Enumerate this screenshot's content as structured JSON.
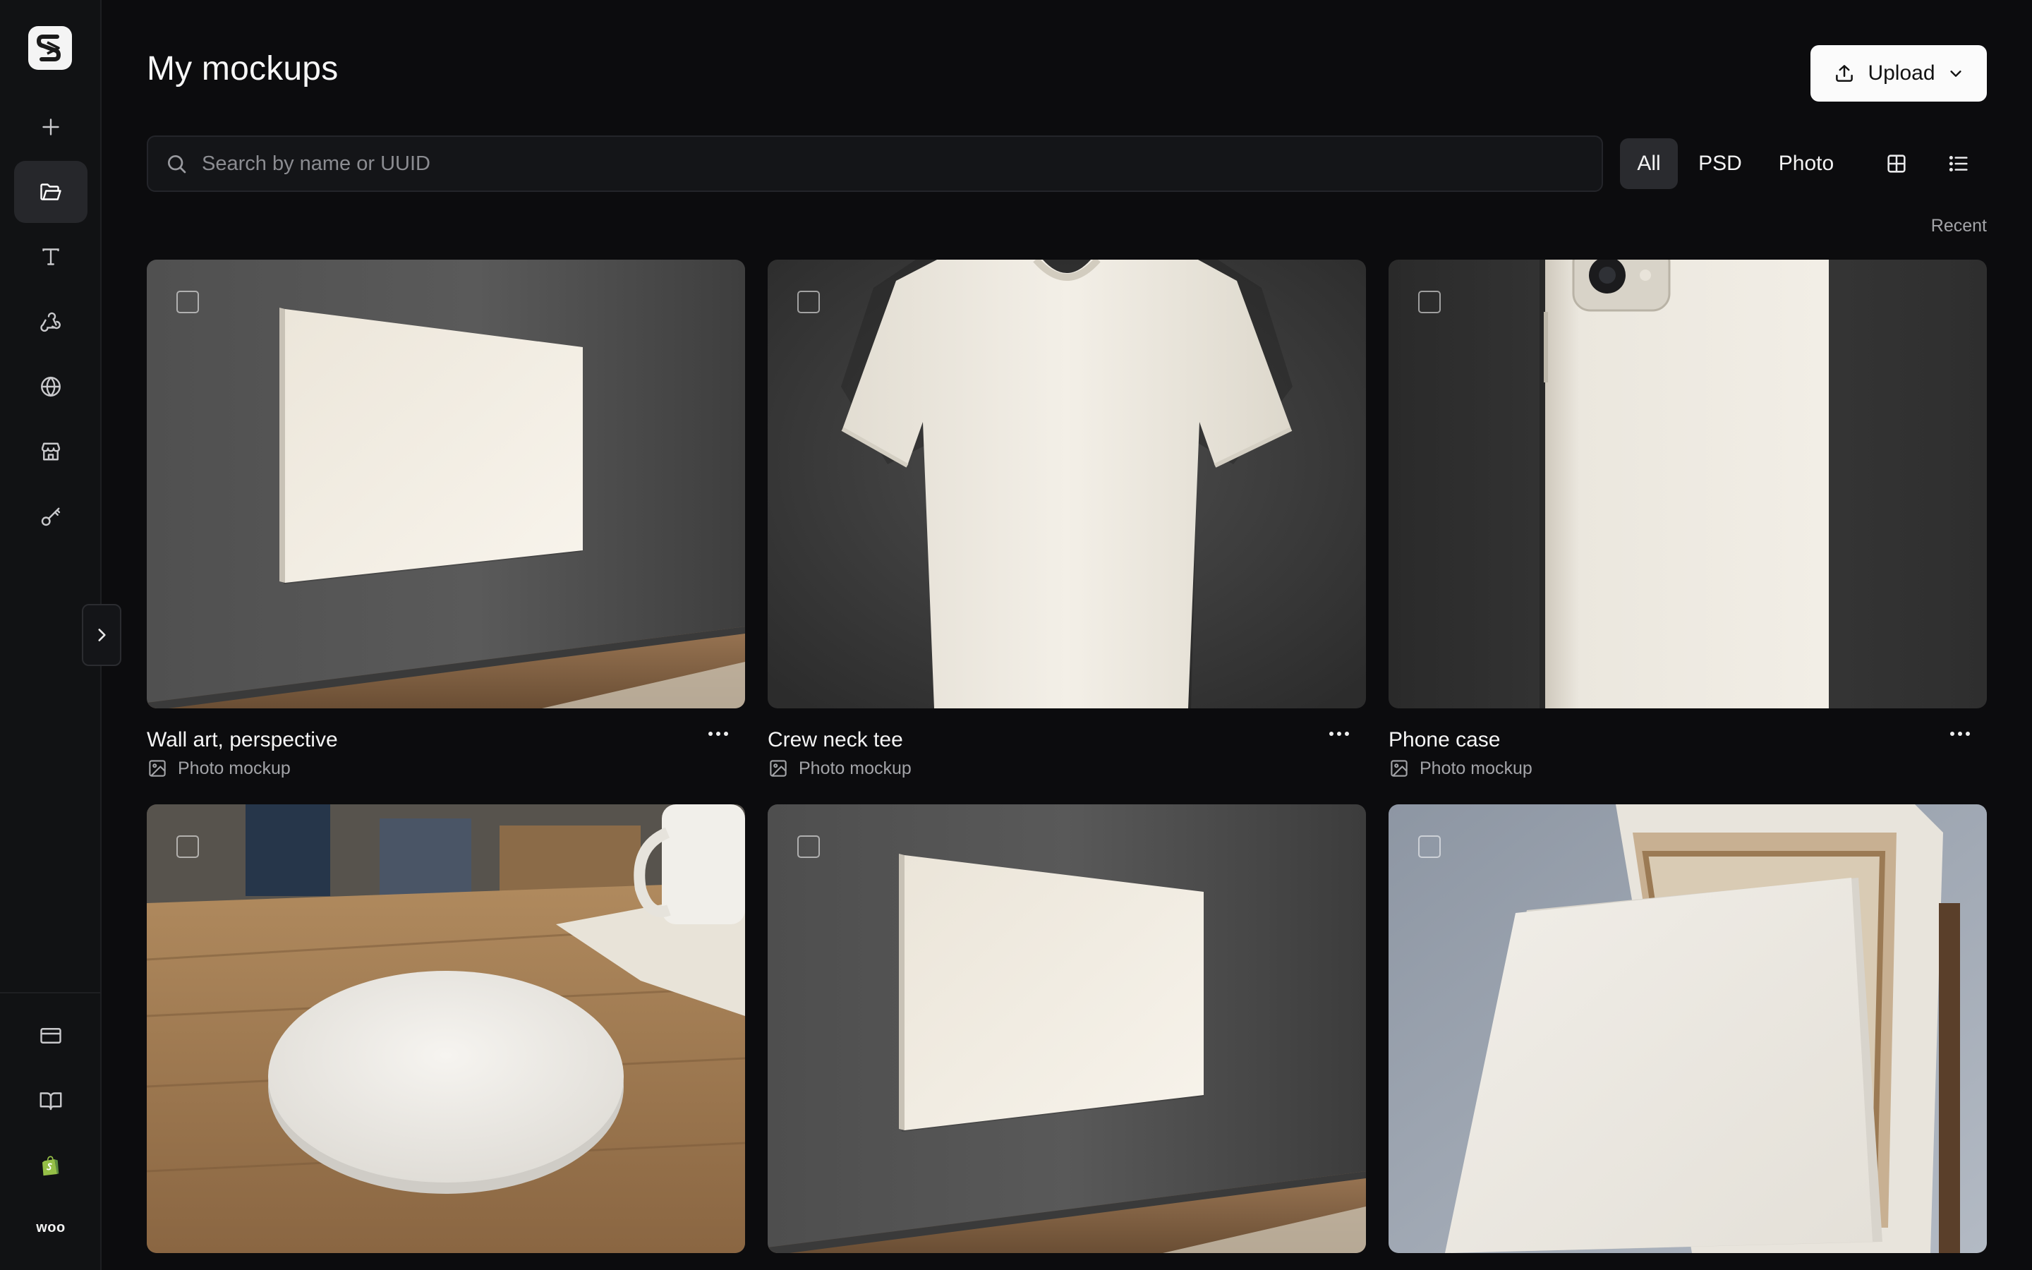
{
  "page": {
    "title": "My mockups"
  },
  "header": {
    "upload_label": "Upload"
  },
  "search": {
    "placeholder": "Search by name or UUID"
  },
  "filters": [
    {
      "label": "All",
      "active": true
    },
    {
      "label": "PSD",
      "active": false
    },
    {
      "label": "Photo",
      "active": false
    }
  ],
  "sort": {
    "label": "Recent"
  },
  "sidebar": {
    "top_items": [
      {
        "icon": "plus-icon"
      },
      {
        "icon": "folder-open-icon",
        "active": true
      },
      {
        "icon": "type-icon"
      },
      {
        "icon": "webhook-icon"
      },
      {
        "icon": "globe-icon"
      },
      {
        "icon": "store-icon"
      },
      {
        "icon": "key-icon"
      }
    ],
    "bottom_items": [
      {
        "icon": "credit-card-icon"
      },
      {
        "icon": "book-open-icon"
      },
      {
        "icon": "shopify-icon"
      },
      {
        "icon": "woo-icon",
        "text": "woo"
      }
    ]
  },
  "mockups": [
    {
      "title": "Wall art, perspective",
      "type": "Photo mockup",
      "scene": "wall-art"
    },
    {
      "title": "Crew neck tee",
      "type": "Photo mockup",
      "scene": "tshirt"
    },
    {
      "title": "Phone case",
      "type": "Photo mockup",
      "scene": "phone-case"
    },
    {
      "title": "",
      "type": "",
      "scene": "coaster"
    },
    {
      "title": "",
      "type": "",
      "scene": "wall-art"
    },
    {
      "title": "",
      "type": "",
      "scene": "canvas-easel"
    }
  ],
  "colors": {
    "background": "#0c0c0e",
    "sidebar": "#111214",
    "active_pill": "#2a2b2f",
    "upload_bg": "#fbfbfb",
    "shopify_green": "#95bf47"
  }
}
